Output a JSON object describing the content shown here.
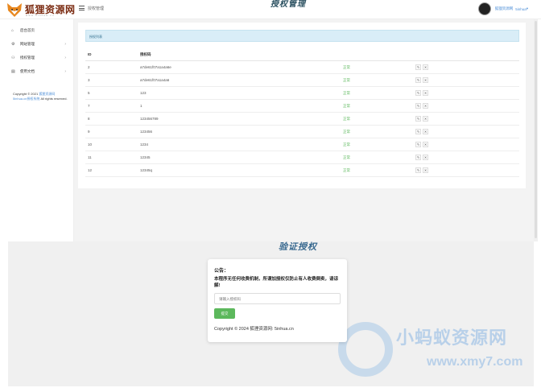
{
  "header": {
    "logo_text": "狐狸资源网",
    "logo_sub": "www.5inhua.cn",
    "breadcrumb": "授权管理",
    "center_title": "授权管理",
    "user_name": "狐狸资源网",
    "user_role": "5inhua"
  },
  "sidebar": {
    "items": [
      {
        "icon": "home-icon",
        "label": "后台首页",
        "has_arrow": false
      },
      {
        "icon": "gear-icon",
        "label": "网站管理",
        "has_arrow": true
      },
      {
        "icon": "users-icon",
        "label": "授权管理",
        "has_arrow": true
      },
      {
        "icon": "doc-icon",
        "label": "使用文档",
        "has_arrow": true
      }
    ],
    "copyright_prefix": "Copyright © 2021 ",
    "copyright_link": "狐狸资源网",
    "copyright_link2": "5inhua.cn授权系统",
    "copyright_suffix": " All rights reserved."
  },
  "main": {
    "alert": "授权列表",
    "columns": [
      "ID",
      "授权码",
      "",
      ""
    ],
    "rows": [
      {
        "id": "2",
        "code": "a7de61f07a1a4a6e",
        "status": "正常"
      },
      {
        "id": "3",
        "code": "a7de61f07a1a4a6",
        "status": "正常"
      },
      {
        "id": "5",
        "code": "123",
        "status": "正常"
      },
      {
        "id": "7",
        "code": "1",
        "status": "正常"
      },
      {
        "id": "8",
        "code": "123456789",
        "status": "正常"
      },
      {
        "id": "9",
        "code": "123456",
        "status": "正常"
      },
      {
        "id": "10",
        "code": "1234",
        "status": "正常"
      },
      {
        "id": "11",
        "code": "12345",
        "status": "正常"
      },
      {
        "id": "12",
        "code": "12345q",
        "status": "正常"
      }
    ],
    "edit_glyph": "✎",
    "delete_glyph": "✕"
  },
  "lower": {
    "title": "验证授权",
    "notice_title": "公告：",
    "notice_body": "本程序无任何收费机制，所谓加授权仅防止有人收费倒卖，请谅解!",
    "input_placeholder": "请输入授权码",
    "submit_label": "提交",
    "copyright": "Copyright © 2024 狐狸资源网: 5inhua.cn"
  },
  "watermark": {
    "text": "小蚂蚁资源网",
    "url": "www.xmy7.com"
  },
  "colors": {
    "accent": "#4e8fd8",
    "success": "#5cb85c",
    "alert_bg": "#d9edf7"
  }
}
